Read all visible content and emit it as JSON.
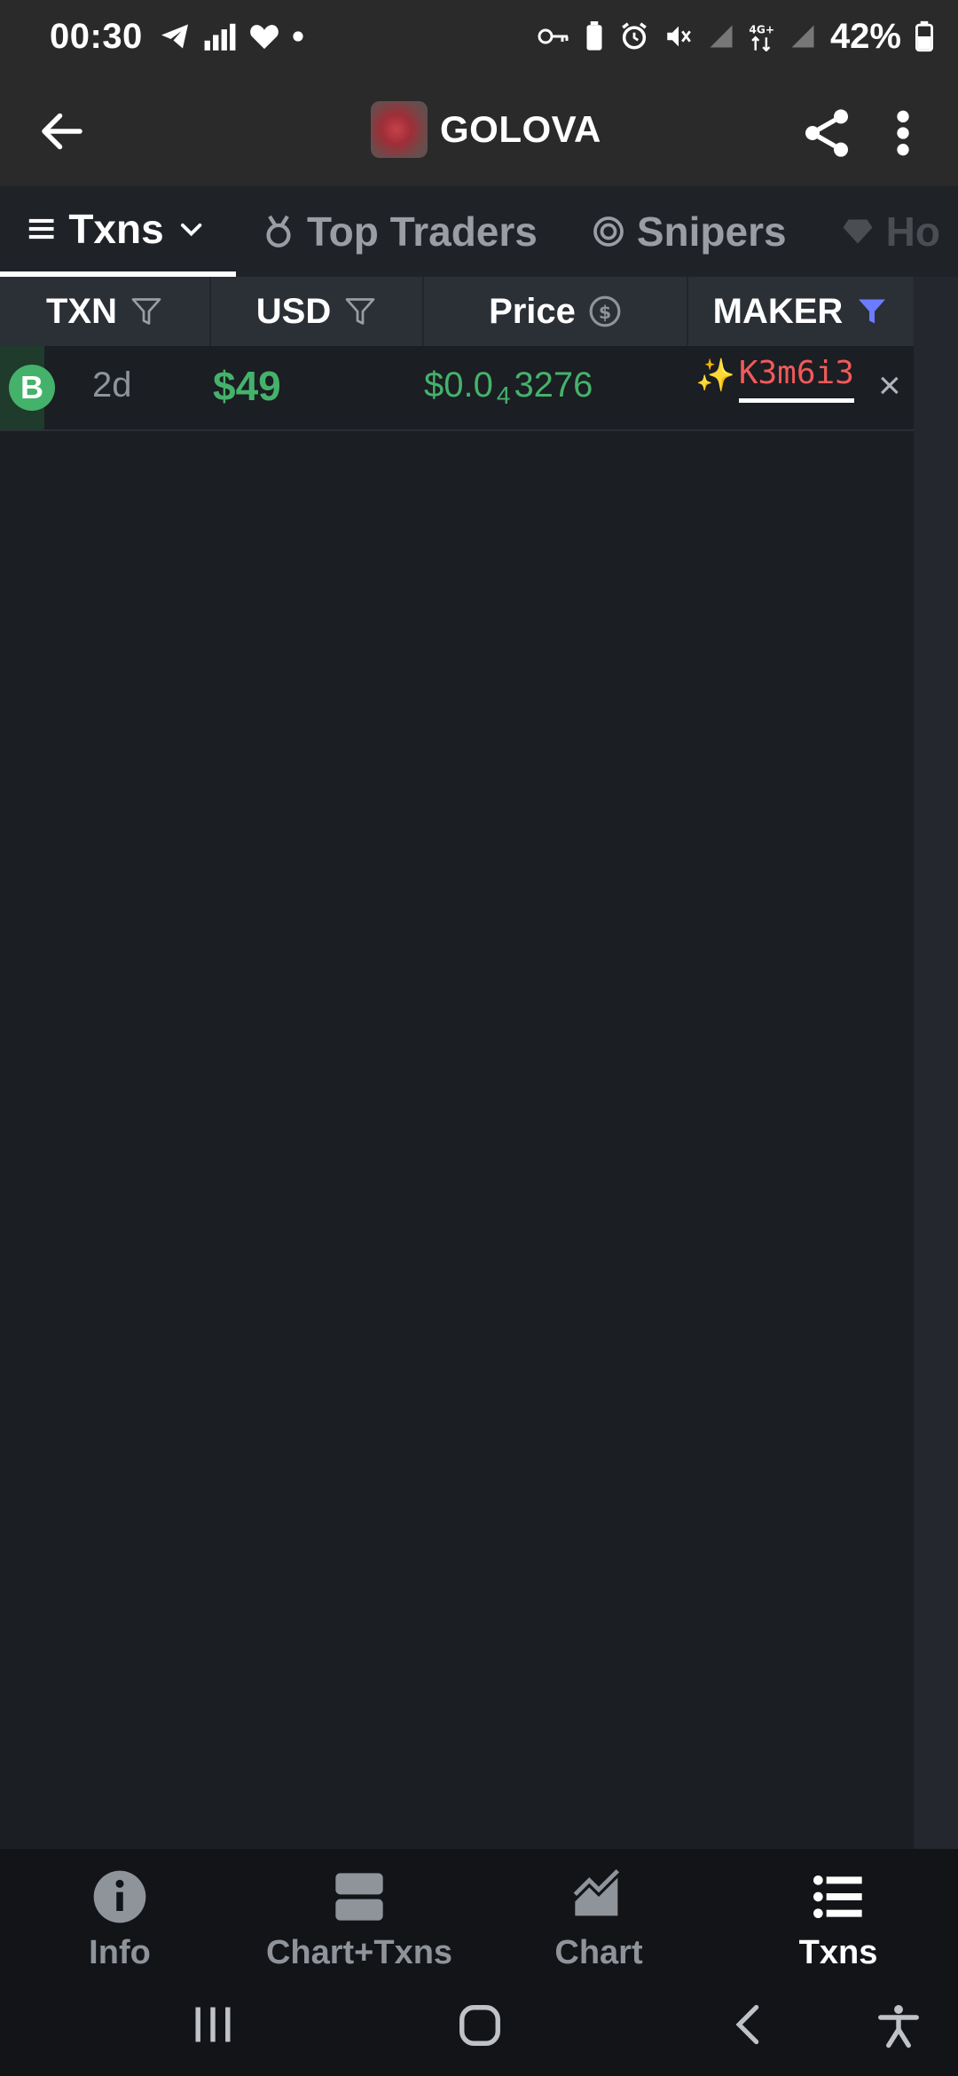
{
  "status_bar": {
    "time": "00:30",
    "battery": "42%",
    "left_icons": [
      "telegram-icon",
      "signal-bars-icon",
      "heart-icon",
      "dot-icon"
    ],
    "right_icons": [
      "key-icon",
      "battery-saver-icon",
      "alarm-icon",
      "mute-icon",
      "signal-icon",
      "4g-icon",
      "signal-icon",
      "battery-icon"
    ]
  },
  "header": {
    "token_name": "GOLOVA",
    "icons": [
      "back-arrow-icon",
      "share-icon",
      "more-vertical-icon"
    ]
  },
  "tabs": [
    {
      "label": "Txns",
      "icon": "list-icon",
      "active": true
    },
    {
      "label": "Top Traders",
      "icon": "medal-icon",
      "active": false
    },
    {
      "label": "Snipers",
      "icon": "target-icon",
      "active": false
    },
    {
      "label": "Ho",
      "icon": "diamond-icon",
      "active": false
    }
  ],
  "table": {
    "columns": [
      "TXN",
      "USD",
      "Price",
      "MAKER"
    ],
    "rows": [
      {
        "type_badge": "B",
        "age": "2d",
        "usd": "$49",
        "price_prefix": "$0.0",
        "price_zeros": "4",
        "price_digits": "3276",
        "maker_emoji": "✨",
        "maker": "K3m6i3",
        "close": "×"
      }
    ]
  },
  "bottom_nav": [
    {
      "label": "Info",
      "icon": "info-icon",
      "active": false
    },
    {
      "label": "Chart+Txns",
      "icon": "split-layout-icon",
      "active": false
    },
    {
      "label": "Chart",
      "icon": "area-chart-icon",
      "active": false
    },
    {
      "label": "Txns",
      "icon": "list-icon",
      "active": true
    }
  ],
  "colors": {
    "buy_green": "#45b26b",
    "maker_red": "#f05a5a",
    "filter_active": "#6b7cff",
    "background": "#1b1e23"
  }
}
